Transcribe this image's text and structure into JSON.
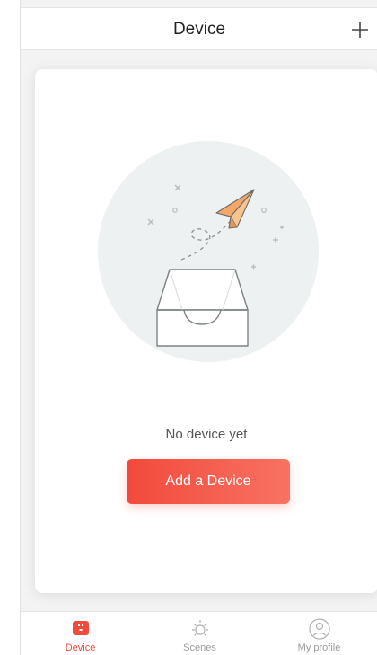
{
  "header": {
    "title": "Device"
  },
  "empty_state": {
    "message": "No device yet",
    "button_label": "Add a Device"
  },
  "tabs": [
    {
      "label": "Device",
      "icon": "device-icon",
      "active": true
    },
    {
      "label": "Scenes",
      "icon": "scenes-icon",
      "active": false
    },
    {
      "label": "My profile",
      "icon": "profile-icon",
      "active": false
    }
  ],
  "colors": {
    "accent": "#f24a3c",
    "background": "#f3f3f3",
    "illustration_circle": "#eef1f1"
  }
}
